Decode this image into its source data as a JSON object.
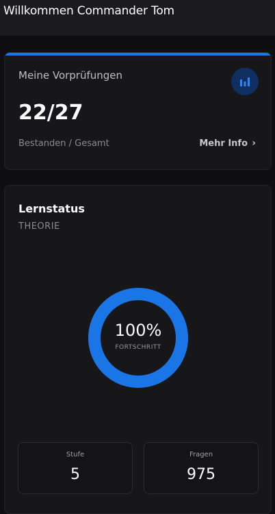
{
  "header": {
    "title": "Willkommen Commander Tom"
  },
  "exam_card": {
    "label": "Meine Vorprüfungen",
    "icon": "bar-chart-icon",
    "value": "22/27",
    "sublabel": "Bestanden / Gesamt",
    "more_label": "Mehr Info",
    "more_chevron": "›",
    "accent_color": "#1a76e6"
  },
  "learn_card": {
    "heading": "Lernstatus",
    "subheading": "THEORIE",
    "progress": {
      "value": 1.0,
      "percent_label": "100%",
      "caption": "FORTSCHRITT",
      "color": "#1a76e6"
    },
    "stats": [
      {
        "label": "Stufe",
        "value": "5"
      },
      {
        "label": "Fragen",
        "value": "975"
      }
    ]
  }
}
